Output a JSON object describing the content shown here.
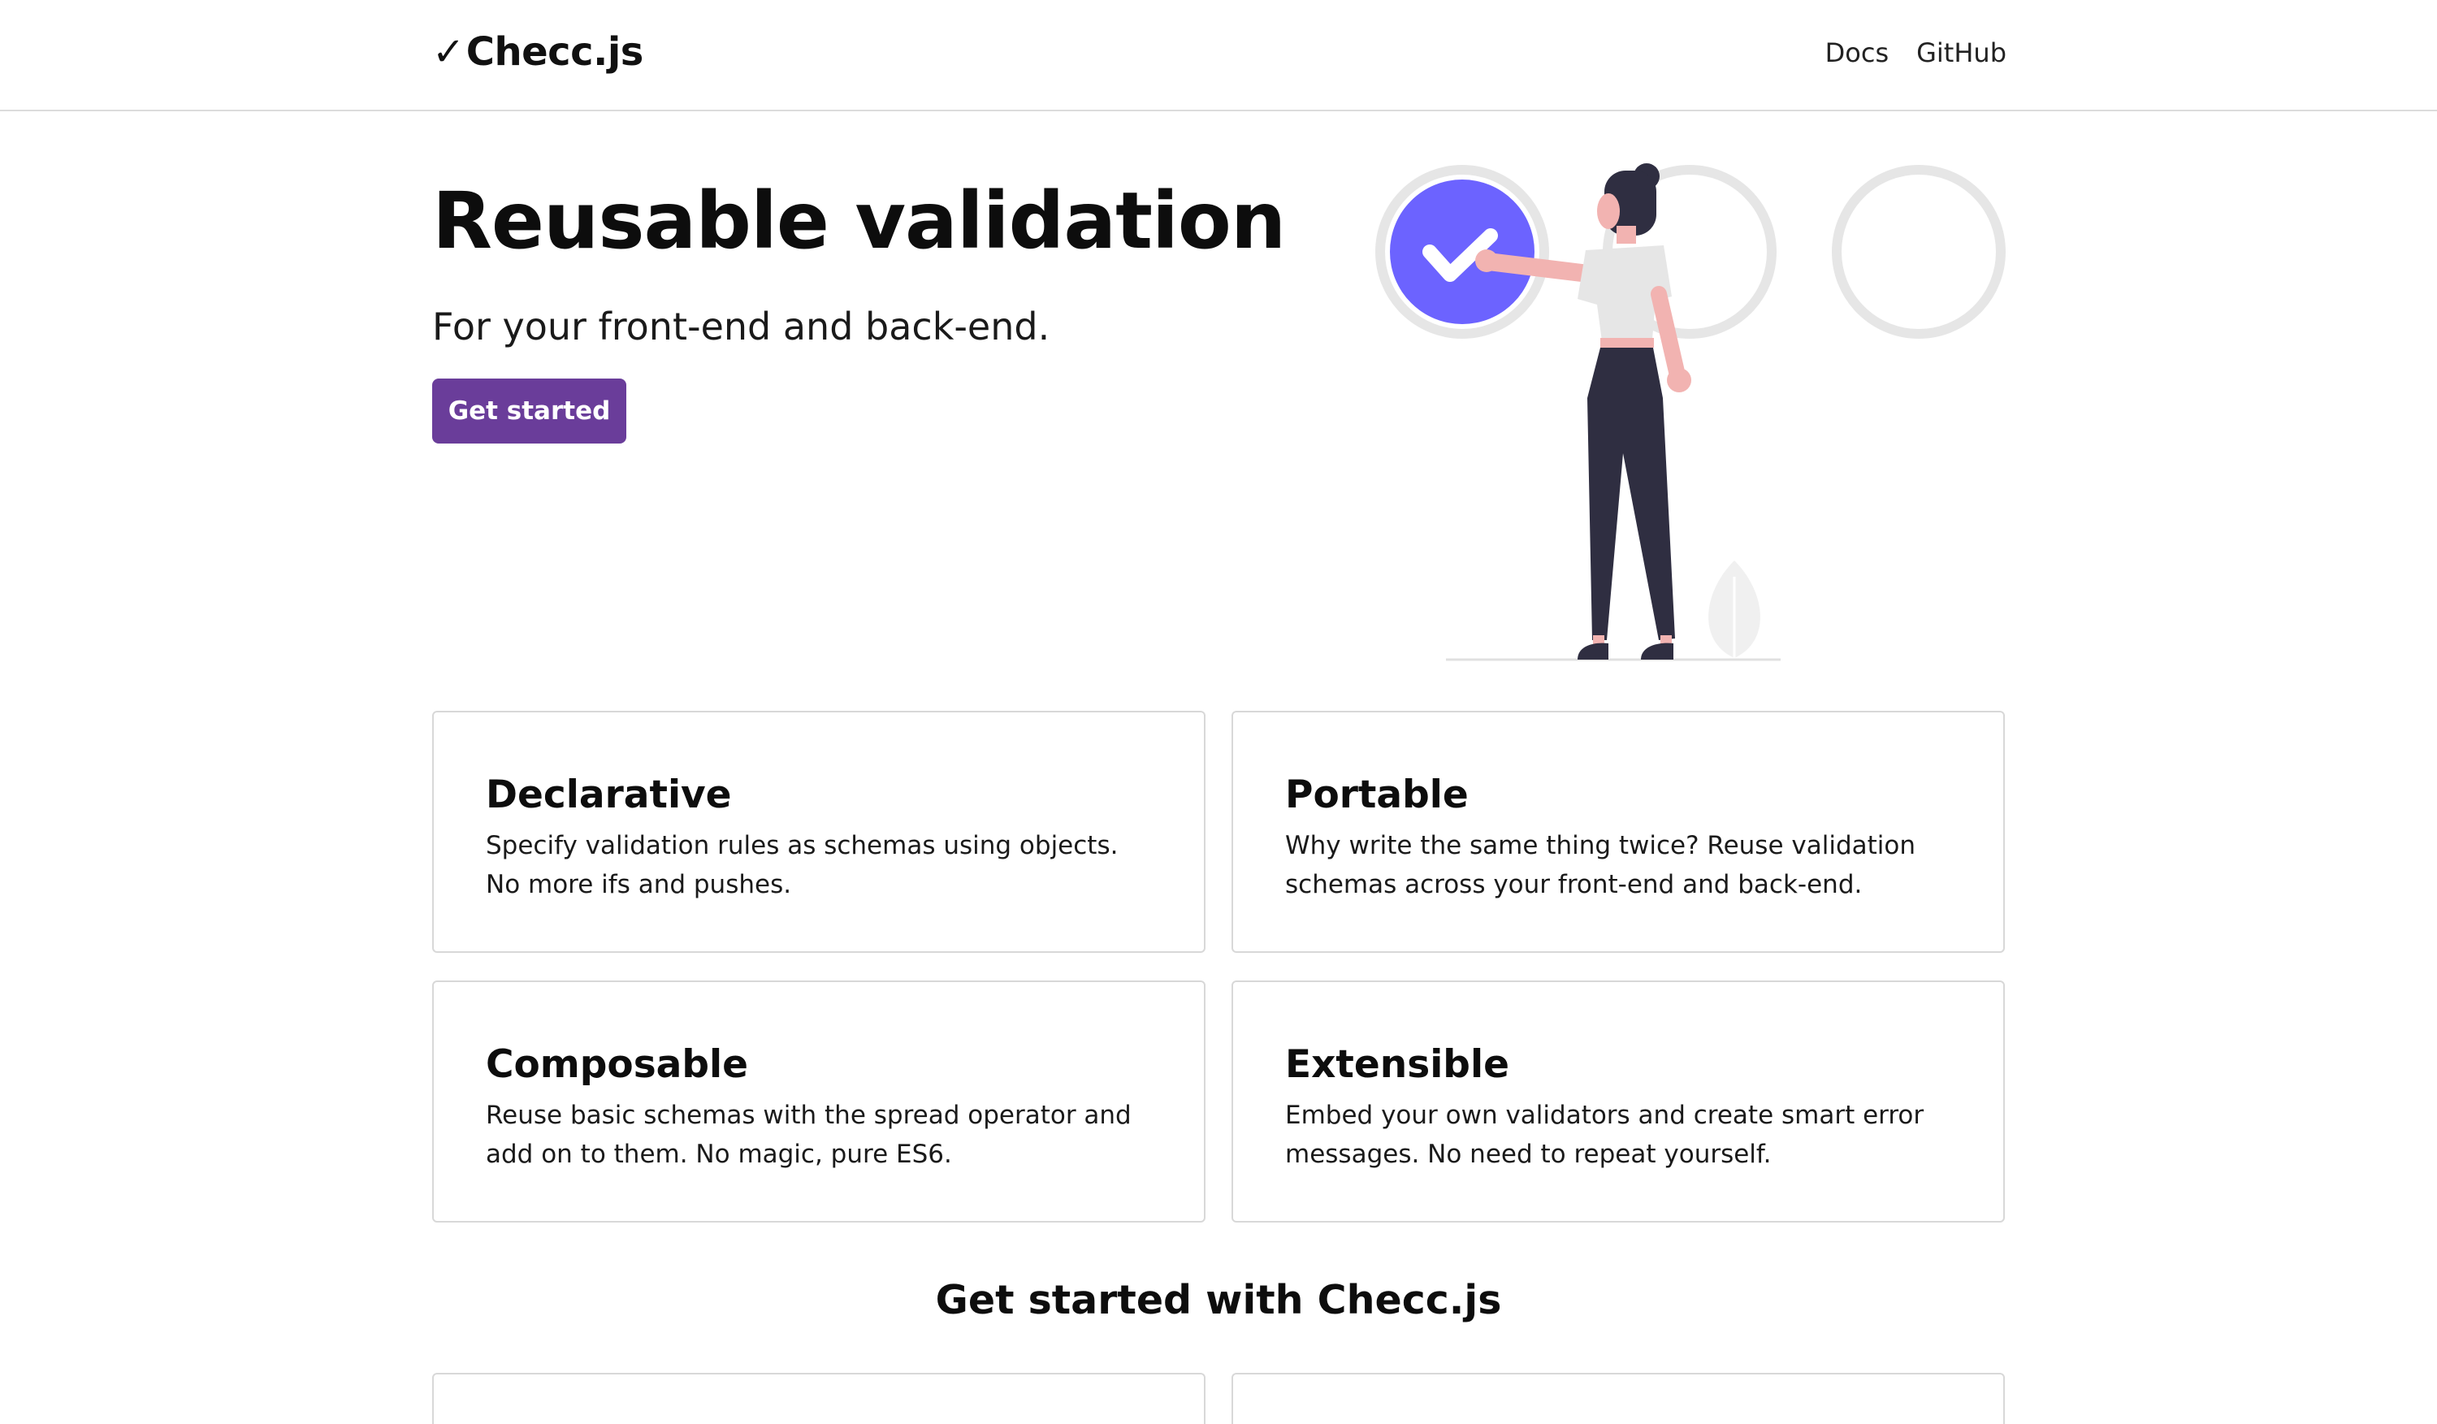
{
  "nav": {
    "brand_check": "✓",
    "brand_name": "Checc.js",
    "links": [
      "Docs",
      "GitHub"
    ]
  },
  "hero": {
    "title": "Reusable validation",
    "subtitle": "For your front-end and back-end.",
    "cta_label": "Get started"
  },
  "features": [
    {
      "title": "Declarative",
      "text": "Specify validation rules as schemas using objects. No more ifs and pushes."
    },
    {
      "title": "Portable",
      "text": "Why write the same thing twice? Reuse validation schemas across your front-end and back-end."
    },
    {
      "title": "Composable",
      "text": "Reuse basic schemas with the spread operator and add on to them. No magic, pure ES6."
    },
    {
      "title": "Extensible",
      "text": "Embed your own validators and create smart error messages. No need to repeat yourself."
    }
  ],
  "get_started": {
    "title": "Get started with Checc.js"
  },
  "colors": {
    "accent": "#6a3d9a",
    "illustration_primary": "#6c63ff",
    "circle_outline": "#e6e6e6",
    "figure_dark": "#2f2e41",
    "skin": "#f2b3b1"
  }
}
